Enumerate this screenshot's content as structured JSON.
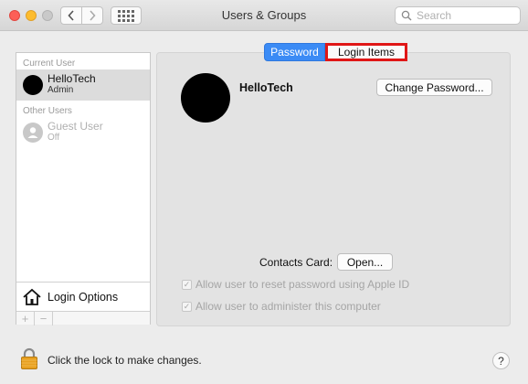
{
  "window": {
    "title": "Users & Groups"
  },
  "toolbar": {
    "back_icon": "chevron-left",
    "forward_icon": "chevron-right",
    "grid_icon": "show-all-grid",
    "search_placeholder": "Search",
    "search_value": ""
  },
  "sidebar": {
    "current_user_header": "Current User",
    "other_users_header": "Other Users",
    "current_user": {
      "name": "HelloTech",
      "role": "Admin"
    },
    "other_users": [
      {
        "name": "Guest User",
        "status": "Off"
      }
    ],
    "login_options_label": "Login Options",
    "add_label": "+",
    "remove_label": "−"
  },
  "tabs": {
    "password": "Password",
    "login_items": "Login Items"
  },
  "account": {
    "name": "HelloTech",
    "change_password_label": "Change Password...",
    "contacts_card_label": "Contacts Card:",
    "open_label": "Open...",
    "allow_reset_label": "Allow user to reset password using Apple ID",
    "allow_admin_label": "Allow user to administer this computer",
    "check_glyph": "✓"
  },
  "footer": {
    "lock_text": "Click the lock to make changes.",
    "help_label": "?"
  },
  "colors": {
    "tab_selected": "#3b8bf5",
    "highlight_box": "#e01616",
    "lock_gold": "#e8a020"
  }
}
